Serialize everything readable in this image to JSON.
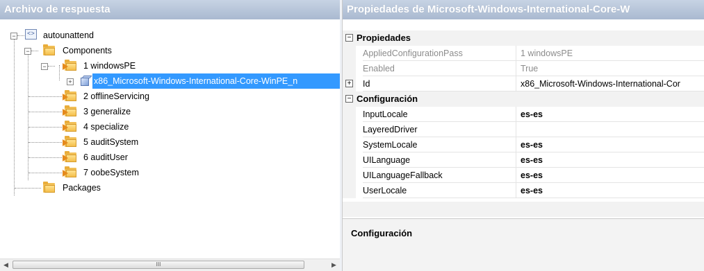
{
  "left_pane": {
    "title": "Archivo de respuesta",
    "tree": {
      "root": "autounattend",
      "components": "Components",
      "passes": [
        {
          "label": "1 windowsPE"
        },
        {
          "label": "2 offlineServicing"
        },
        {
          "label": "3 generalize"
        },
        {
          "label": "4 specialize"
        },
        {
          "label": "5 auditSystem"
        },
        {
          "label": "6 auditUser"
        },
        {
          "label": "7 oobeSystem"
        }
      ],
      "selected_component": "x86_Microsoft-Windows-International-Core-WinPE_n",
      "packages": "Packages"
    },
    "scroll_grip": "III"
  },
  "right_pane": {
    "title": "Propiedades de Microsoft-Windows-International-Core-W",
    "categories": {
      "properties": "Propiedades",
      "configuration": "Configuración"
    },
    "properties": [
      {
        "name": "AppliedConfigurationPass",
        "value": "1 windowsPE"
      },
      {
        "name": "Enabled",
        "value": "True"
      },
      {
        "name": "Id",
        "value": "x86_Microsoft-Windows-International-Cor"
      }
    ],
    "configuration": [
      {
        "name": "InputLocale",
        "value": "es-es"
      },
      {
        "name": "LayeredDriver",
        "value": ""
      },
      {
        "name": "SystemLocale",
        "value": "es-es"
      },
      {
        "name": "UILanguage",
        "value": "es-es"
      },
      {
        "name": "UILanguageFallback",
        "value": "es-es"
      },
      {
        "name": "UserLocale",
        "value": "es-es"
      }
    ],
    "description_title": "Configuración"
  },
  "icons": {
    "expand": "plus-box-icon",
    "collapse": "minus-box-icon",
    "folder": "folder-icon",
    "pass": "pass-folder-icon",
    "component": "component-cube-icon",
    "answer_file": "answer-file-icon"
  },
  "colors": {
    "header_gradient_top": "#c7d3e4",
    "header_gradient_bottom": "#a9b9d0",
    "selection": "#3399ff",
    "readonly_text": "#8c8c8c"
  }
}
